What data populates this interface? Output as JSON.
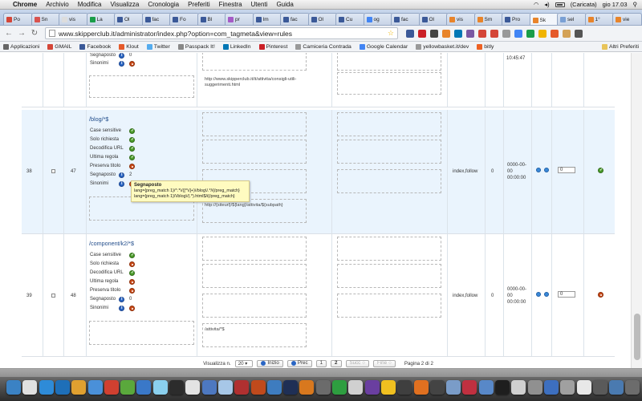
{
  "menubar": {
    "app": "Chrome",
    "items": [
      "Archivio",
      "Modifica",
      "Visualizza",
      "Cronologia",
      "Preferiti",
      "Finestra",
      "Utenti",
      "Guida"
    ],
    "battery": "(Caricata)",
    "clock": "gio 17.03"
  },
  "tabs": [
    {
      "label": "Po",
      "color": "#d44638"
    },
    {
      "label": "Sn",
      "color": "#d9534f"
    },
    {
      "label": "vis",
      "color": "#dddddd"
    },
    {
      "label": "La",
      "color": "#1a9d49"
    },
    {
      "label": "Ol",
      "color": "#3b5998"
    },
    {
      "label": "fac",
      "color": "#3b5998"
    },
    {
      "label": "Fo",
      "color": "#3b5998"
    },
    {
      "label": "Bl",
      "color": "#3b5998"
    },
    {
      "label": "pr",
      "color": "#a55bc6"
    },
    {
      "label": "Im",
      "color": "#3b5998"
    },
    {
      "label": "fac",
      "color": "#3b5998"
    },
    {
      "label": "Ol",
      "color": "#3b5998"
    },
    {
      "label": "Cu",
      "color": "#3b5998"
    },
    {
      "label": "og",
      "color": "#4285f4"
    },
    {
      "label": "fac",
      "color": "#3b5998"
    },
    {
      "label": "Ol",
      "color": "#3b5998"
    },
    {
      "label": "vis",
      "color": "#e8842a"
    },
    {
      "label": "Sm",
      "color": "#e8842a"
    },
    {
      "label": "Pro",
      "color": "#3b5998"
    },
    {
      "label": "Sk",
      "color": "#e8842a"
    },
    {
      "label": "sel",
      "color": "#7aa0d4"
    },
    {
      "label": "1°",
      "color": "#e8842a"
    },
    {
      "label": "vie",
      "color": "#e8842a"
    }
  ],
  "address": {
    "url": "www.skipperclub.it/administrator/index.php?option=com_tagmeta&view=rules"
  },
  "bookmarks": [
    {
      "label": "Applicazioni",
      "color": "#666666"
    },
    {
      "label": "GMAIL",
      "color": "#d44638"
    },
    {
      "label": "Facebook",
      "color": "#3b5998"
    },
    {
      "label": "Klout",
      "color": "#e55a2b"
    },
    {
      "label": "Twitter",
      "color": "#55acee"
    },
    {
      "label": "Passpack It!",
      "color": "#888888"
    },
    {
      "label": "LinkedIn",
      "color": "#0077b5"
    },
    {
      "label": "Pinterest",
      "color": "#cb2027"
    },
    {
      "label": "Camiceria Contrada",
      "color": "#999999"
    },
    {
      "label": "Google Calendar",
      "color": "#4285f4"
    },
    {
      "label": "yellowbasket.it/dev",
      "color": "#999999"
    },
    {
      "label": "bitly",
      "color": "#ee6123"
    }
  ],
  "bookmarks_other": "Altri Preferiti",
  "top_partial": {
    "prop_labels": [
      "Segnaposto",
      "Sinonimi"
    ],
    "prop_value": "0",
    "url": "http://www.skipperclub.it/it/attivita/consigli-utili-suggerimenti.html",
    "date_fragment": "10:45:47"
  },
  "rows": [
    {
      "num": "38",
      "id": "47",
      "title": "/blog/*$",
      "props": [
        {
          "label": "Case sensitive",
          "state": "ok"
        },
        {
          "label": "Solo richiesta",
          "state": "ok"
        },
        {
          "label": "Decodifica URL",
          "state": "ok"
        },
        {
          "label": "Ultima regola",
          "state": "ok"
        },
        {
          "label": "Preserva titolo",
          "state": "no"
        },
        {
          "label": "Segnaposto",
          "state": "info",
          "value": "2"
        },
        {
          "label": "Sinonimi",
          "state": "info"
        }
      ],
      "url": "http://{siteurl}/${lang}/attivita/${subpath}",
      "robots": "index,follow",
      "hits": "0",
      "date": [
        "0000-00-",
        "00",
        "00:00:00"
      ],
      "order": "0",
      "published": "ok"
    },
    {
      "num": "39",
      "id": "48",
      "title": "/component/k2/*$",
      "props": [
        {
          "label": "Case sensitive",
          "state": "ok"
        },
        {
          "label": "Solo richiesta",
          "state": "no"
        },
        {
          "label": "Decodifica URL",
          "state": "ok"
        },
        {
          "label": "Ultima regola",
          "state": "no"
        },
        {
          "label": "Preserva titolo",
          "state": "no"
        },
        {
          "label": "Segnaposto",
          "state": "info",
          "value": "0"
        },
        {
          "label": "Sinonimi",
          "state": "info"
        }
      ],
      "url": "/attivita/*$",
      "robots": "index,follow",
      "hits": "0",
      "date": [
        "0000-00-",
        "00",
        "00:00:00"
      ],
      "order": "0",
      "published": "no"
    }
  ],
  "tooltip": {
    "title": "Segnaposto",
    "line1": "lang={preg_match 1}/^.*\\/([^\\/]+)\\/blog\\/.*/i{/preg_match}",
    "line2": "lang={preg_match 1}/\\/blog\\/(.*).html$/i{/preg_match}"
  },
  "pager": {
    "display_label": "Visualizza n.",
    "display_value": "20",
    "start": "Inizio",
    "prev": "Prec",
    "pages": [
      "1",
      "2"
    ],
    "next": "Succ",
    "end": "Fine",
    "page_info": "Pagina 2 di 2"
  },
  "colors": {
    "ok": "#4a9b29",
    "no": "#c94b1a",
    "info": "#2a66c4",
    "highlight_row": "#eaf4fd"
  }
}
